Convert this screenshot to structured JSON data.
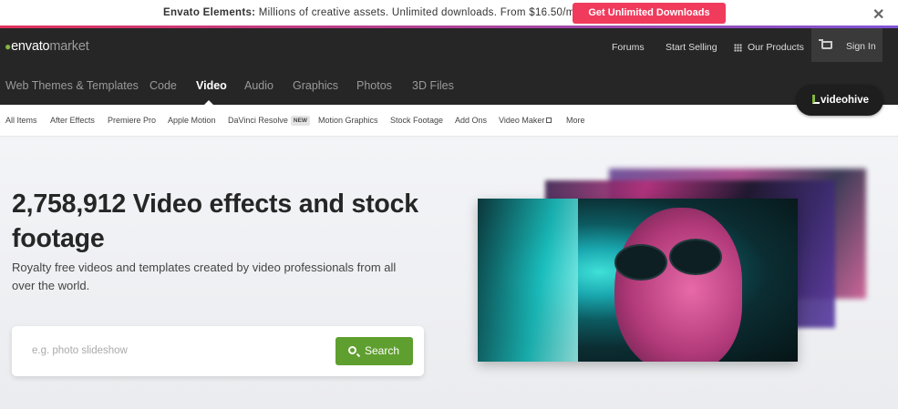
{
  "promo": {
    "brand": "Envato Elements:",
    "text": " Millions of creative assets. Unlimited downloads. From $16.50/m.",
    "cta": "Get Unlimited Downloads",
    "close": "✕"
  },
  "header": {
    "logo_envato": "envato",
    "logo_market": "market",
    "top_links": [
      "Forums",
      "Start Selling",
      "Our Products",
      "Sign In"
    ],
    "categories": [
      "Web Themes & Templates",
      "Code",
      "Video",
      "Audio",
      "Graphics",
      "Photos",
      "3D Files"
    ],
    "active_category": "Video",
    "site_badge": "videohive"
  },
  "subnav": {
    "items": [
      "All Items",
      "After Effects",
      "Premiere Pro",
      "Apple Motion",
      "DaVinci Resolve",
      "Motion Graphics",
      "Stock Footage",
      "Add Ons",
      "Video Maker",
      "More"
    ],
    "new_badge": "NEW"
  },
  "hero": {
    "title": "2,758,912 Video effects and stock footage",
    "subtitle": "Royalty free videos and templates created by video professionals from all over the world.",
    "search_placeholder": "e.g. photo slideshow",
    "search_button": "Search"
  },
  "colors": {
    "promo_button": "#f03b5c",
    "header_bg": "#262626",
    "search_button": "#5f9f2f",
    "brand_green": "#82b541"
  }
}
